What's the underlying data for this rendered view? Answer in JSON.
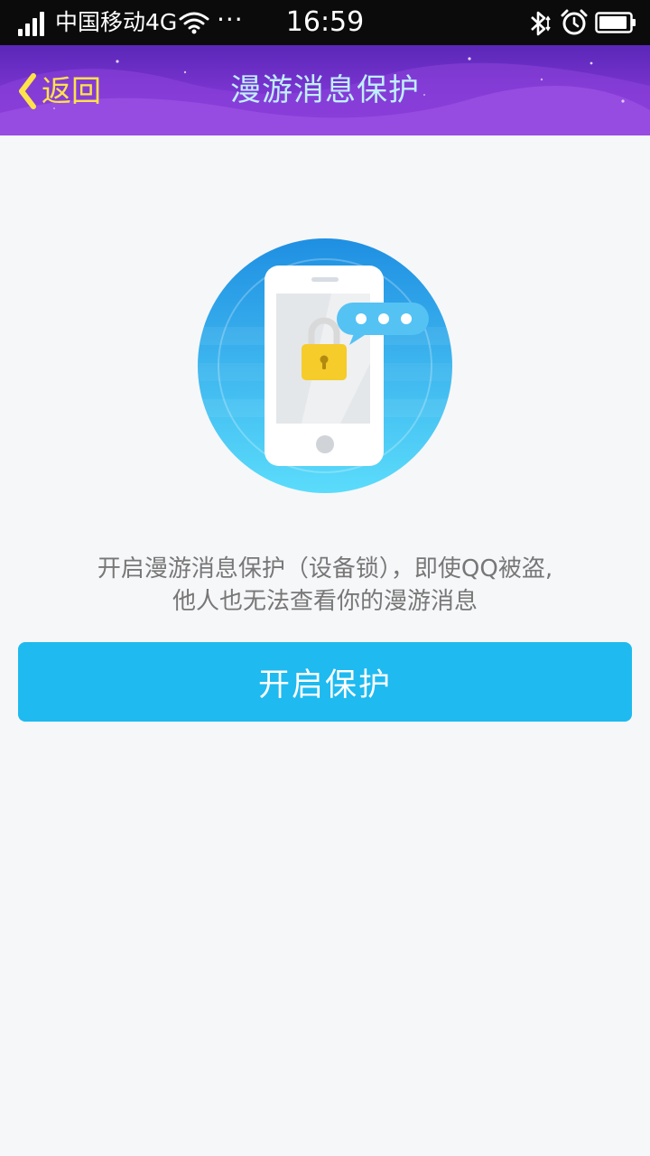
{
  "status_bar": {
    "carrier": "中国移动4G",
    "more": "···",
    "time": "16:59",
    "icons": [
      "signal-icon",
      "wifi-icon",
      "bluetooth-icon",
      "alarm-icon",
      "battery-icon"
    ]
  },
  "header": {
    "back_label": "返回",
    "title": "漫游消息保护"
  },
  "main": {
    "description_line1": "开启漫游消息保护（设备锁），即使QQ被盗,",
    "description_line2": "他人也无法查看你的漫游消息",
    "enable_button_label": "开启保护"
  },
  "colors": {
    "header_purple": "#7a34cf",
    "back_yellow": "#ffe24a",
    "title_cyan": "#bfefff",
    "primary_button": "#1ebaf0",
    "circle_blue": "#2a9be6",
    "lock_yellow": "#f5cc2a"
  }
}
